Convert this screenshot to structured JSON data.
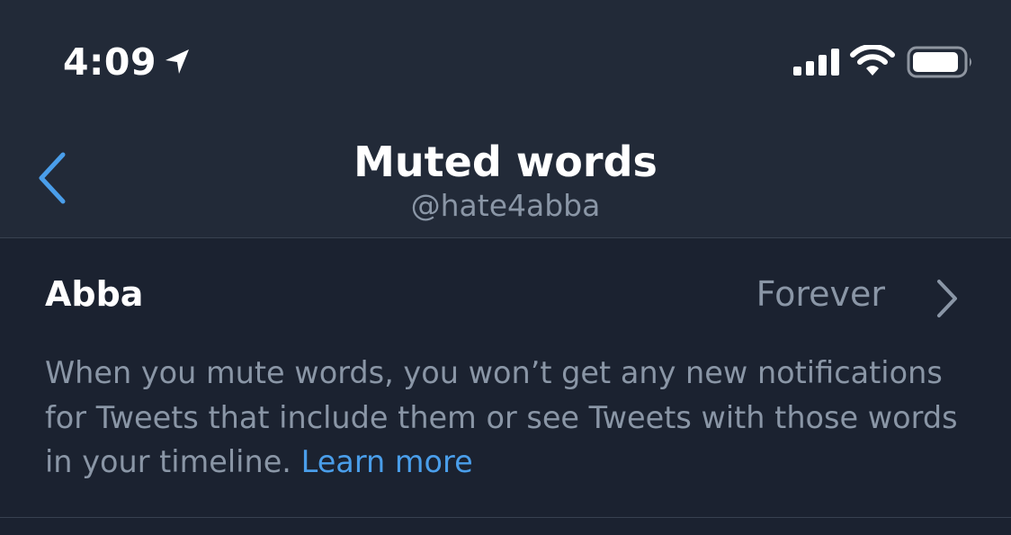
{
  "status_bar": {
    "time": "4:09"
  },
  "nav": {
    "title": "Muted words",
    "handle": "@hate4abba"
  },
  "muted_words": [
    {
      "word": "Abba",
      "duration": "Forever"
    }
  ],
  "info": {
    "text": "When you mute words, you won’t get any new notifications for Tweets that include them or see Tweets with those words in your timeline.",
    "link_label": "Learn more"
  },
  "icons": {
    "location": "location-arrow-icon",
    "signal": "cellular-signal-icon",
    "wifi": "wifi-icon",
    "battery": "battery-icon",
    "back": "chevron-left-icon",
    "row_chevron": "chevron-right-icon"
  },
  "colors": {
    "header_bg": "#222a38",
    "page_bg": "#1b2230",
    "accent": "#4a9eea",
    "secondary_text": "#8a96a6"
  }
}
